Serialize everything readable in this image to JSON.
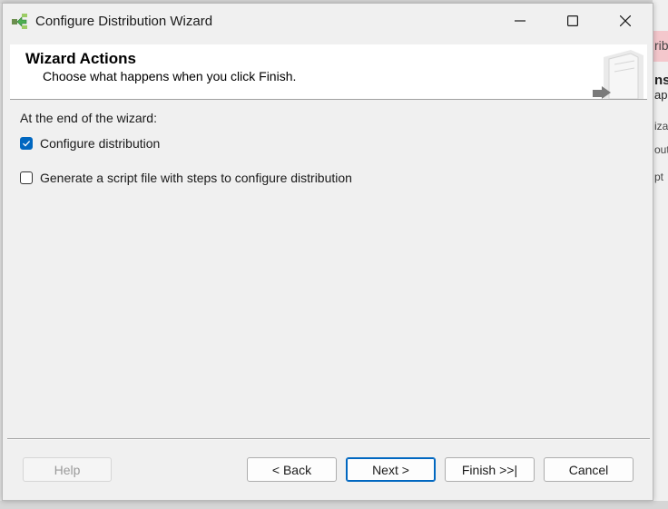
{
  "window": {
    "title": "Configure Distribution Wizard"
  },
  "header": {
    "title": "Wizard Actions",
    "subtitle": "Choose what happens when you click Finish."
  },
  "body": {
    "section_label": "At the end of the wizard:",
    "options": [
      {
        "label": "Configure distribution",
        "checked": true
      },
      {
        "label": "Generate a script file with steps to configure distribution",
        "checked": false
      }
    ]
  },
  "buttons": {
    "help": "Help",
    "back": "< Back",
    "next": "Next >",
    "finish": "Finish >>|",
    "cancel": "Cancel"
  },
  "background_app": {
    "fragments": [
      "rib",
      "ns",
      "app",
      "iza",
      "out",
      "pt"
    ]
  },
  "colors": {
    "accent": "#0067c0",
    "dialog_bg": "#f0f0f0",
    "header_bg": "#ffffff"
  },
  "icons": {
    "app": "wizard-arrows-icon",
    "header": "server-arrow-icon"
  }
}
